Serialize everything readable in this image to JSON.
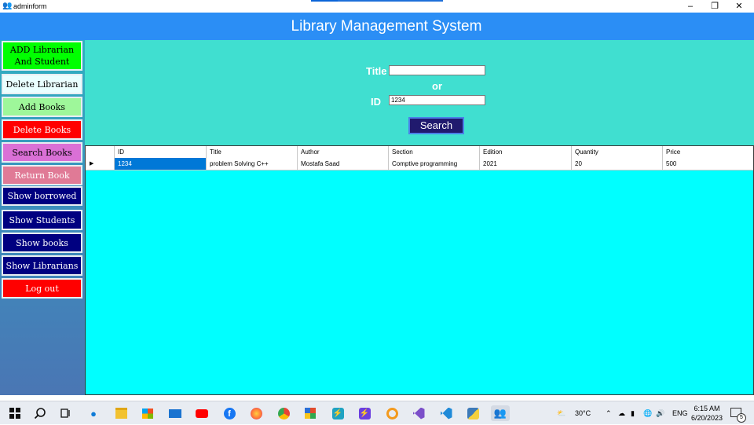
{
  "window": {
    "title": "adminform"
  },
  "header": {
    "title": "Library Management System"
  },
  "sidebar": {
    "items": [
      {
        "label": "ADD Librarian\nAnd Student",
        "bg": "#00ff00",
        "fg": "#000000"
      },
      {
        "label": "Delete Librarian",
        "bg": "#eaffff",
        "fg": "#000000"
      },
      {
        "label": "Add Books",
        "bg": "#9ef79a",
        "fg": "#000000"
      },
      {
        "label": "Delete Books",
        "bg": "#ff0000",
        "fg": "#ffffff"
      },
      {
        "label": "Search Books",
        "bg": "#da70d6",
        "fg": "#000000"
      },
      {
        "label": "Return Book",
        "bg": "#e07a96",
        "fg": "#ffffff"
      },
      {
        "label": "Show borrowed",
        "bg": "#000080",
        "fg": "#ffffff"
      },
      {
        "label": "Show Students",
        "bg": "#000080",
        "fg": "#ffffff"
      },
      {
        "label": "Show books",
        "bg": "#000080",
        "fg": "#ffffff"
      },
      {
        "label": "Show Librarians",
        "bg": "#000080",
        "fg": "#ffffff"
      },
      {
        "label": "Log out",
        "bg": "#ff0000",
        "fg": "#ffffff"
      }
    ]
  },
  "search": {
    "title_label": "Title",
    "title_value": "",
    "or_label": "or",
    "id_label": "ID",
    "id_value": "1234",
    "button_label": "Search"
  },
  "table": {
    "columns": [
      "ID",
      "Title",
      "Author",
      "Section",
      "Edition",
      "Quantity",
      "Price"
    ],
    "rows": [
      [
        "1234",
        "problem Solving C++",
        "Mostafa Saad",
        "Comptive programming",
        "2021",
        "20",
        "500"
      ]
    ],
    "current_row_marker": "▶"
  },
  "taskbar": {
    "weather": "30°C",
    "language": "ENG",
    "time": "6:15 AM",
    "date": "6/20/2023",
    "notifications": "5",
    "apps": [
      "start-icon",
      "search-icon",
      "task-view-icon",
      "edge-icon",
      "file-explorer-icon",
      "store-icon",
      "mail-icon",
      "youtube-icon",
      "facebook-icon",
      "firefox-icon",
      "chrome-icon",
      "app-grid-icon",
      "zap-icon",
      "bolt-icon",
      "github-icon",
      "visual-studio-icon",
      "vscode-icon",
      "python-icon",
      "adminform-app-icon"
    ]
  },
  "colors": {
    "banner": "#2b8ef5",
    "search_panel": "#40dfd0",
    "grid_background": "#00ffff",
    "selected_cell": "#0078d7",
    "search_button": "#201a6e"
  }
}
